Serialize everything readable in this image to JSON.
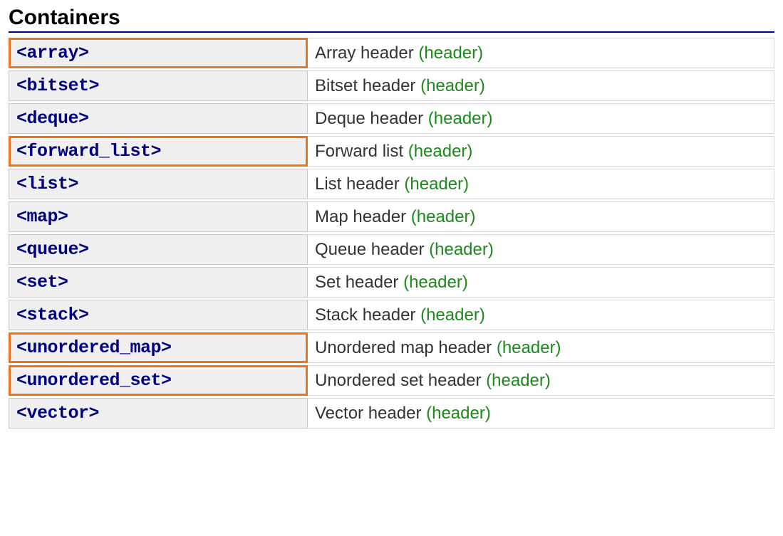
{
  "section_title": "Containers",
  "tag_label": "(header)",
  "rows": [
    {
      "name": "<array>",
      "description": "Array header",
      "highlighted": true
    },
    {
      "name": "<bitset>",
      "description": "Bitset header",
      "highlighted": false
    },
    {
      "name": "<deque>",
      "description": "Deque header",
      "highlighted": false
    },
    {
      "name": "<forward_list>",
      "description": "Forward list",
      "highlighted": true
    },
    {
      "name": "<list>",
      "description": "List header",
      "highlighted": false
    },
    {
      "name": "<map>",
      "description": "Map header",
      "highlighted": false
    },
    {
      "name": "<queue>",
      "description": "Queue header",
      "highlighted": false
    },
    {
      "name": "<set>",
      "description": "Set header",
      "highlighted": false
    },
    {
      "name": "<stack>",
      "description": "Stack header",
      "highlighted": false
    },
    {
      "name": "<unordered_map>",
      "description": "Unordered map header",
      "highlighted": true
    },
    {
      "name": "<unordered_set>",
      "description": "Unordered set header",
      "highlighted": true
    },
    {
      "name": "<vector>",
      "description": "Vector header",
      "highlighted": false
    }
  ]
}
